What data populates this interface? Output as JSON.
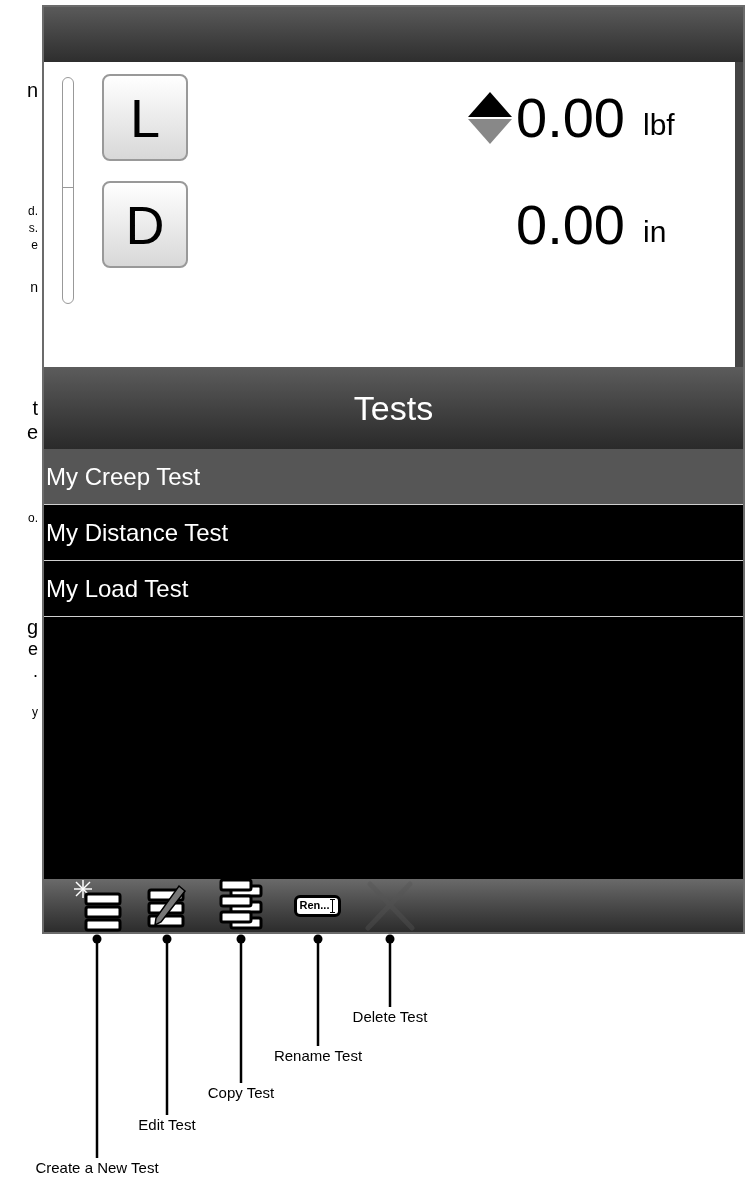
{
  "margin_fragments": [
    "n",
    "d.",
    "s.",
    "e",
    "n",
    "t",
    "e",
    "o.",
    "g",
    "e",
    ".",
    "y"
  ],
  "readings": [
    {
      "button": "L",
      "value": "0.00",
      "unit": "lbf",
      "direction_indicator": true
    },
    {
      "button": "D",
      "value": "0.00",
      "unit": "in",
      "direction_indicator": false
    }
  ],
  "tests": {
    "title": "Tests",
    "rows": [
      {
        "label": "My Creep Test",
        "selected": true
      },
      {
        "label": "My Distance Test",
        "selected": false
      },
      {
        "label": "My Load Test",
        "selected": false
      }
    ]
  },
  "toolbar": [
    {
      "kind": "create",
      "callout": "Create a New Test",
      "disabled": false
    },
    {
      "kind": "edit",
      "callout": "Edit Test",
      "disabled": false
    },
    {
      "kind": "copy",
      "callout": "Copy Test",
      "disabled": false
    },
    {
      "kind": "rename",
      "icon_text": "Ren...",
      "callout": "Rename Test",
      "disabled": false
    },
    {
      "kind": "delete",
      "callout": "Delete Test",
      "disabled": true
    }
  ]
}
